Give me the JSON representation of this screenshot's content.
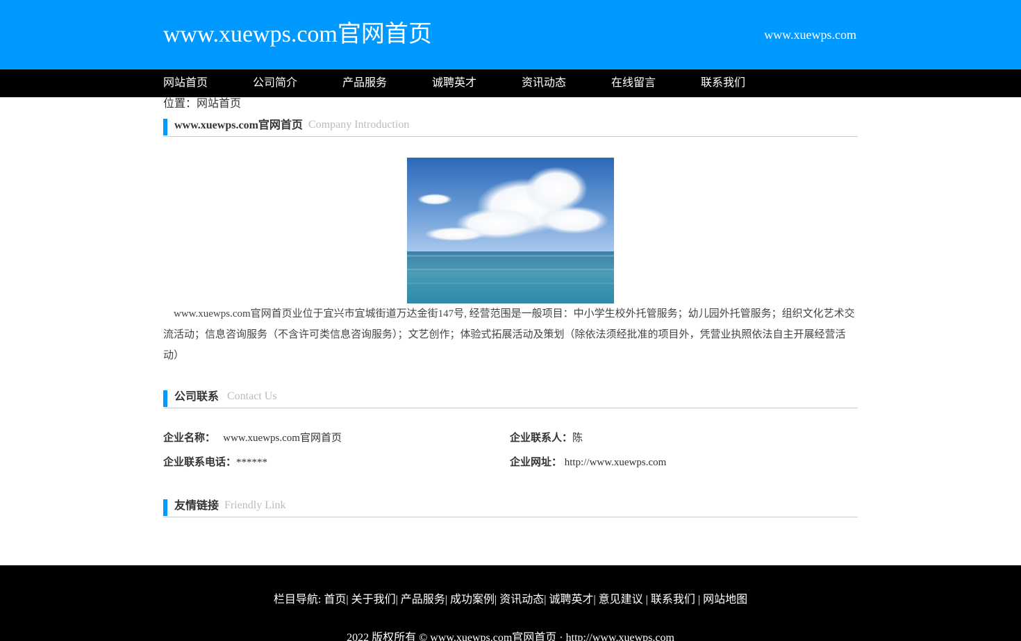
{
  "header": {
    "title": "www.xuewps.com官网首页",
    "url": "www.xuewps.com"
  },
  "nav": {
    "items": [
      "网站首页",
      "公司简介",
      "产品服务",
      "诚聘英才",
      "资讯动态",
      "在线留言",
      "联系我们"
    ]
  },
  "breadcrumb": "位置：网站首页",
  "intro": {
    "heading": "www.xuewps.com官网首页",
    "heading_en": "Company Introduction",
    "text": "www.xuewps.com官网首页业位于宜兴市宜城街道万达金街147号, 经营范围是一般项目：中小学生校外托管服务；幼儿园外托管服务；组织文化艺术交流活动；信息咨询服务（不含许可类信息咨询服务）；文艺创作；体验式拓展活动及策划（除依法须经批准的项目外，凭营业执照依法自主开展经营活动）"
  },
  "contact": {
    "heading": "公司联系",
    "heading_en": "Contact Us",
    "name_label": "企业名称：",
    "name_value": "www.xuewps.com官网首页",
    "person_label": "企业联系人：",
    "person_value": "陈",
    "phone_label": "企业联系电话：",
    "phone_value": "******",
    "site_label": "企业网址：",
    "site_value": "http://www.xuewps.com"
  },
  "links": {
    "heading": "友情链接",
    "heading_en": "Friendly Link"
  },
  "footer": {
    "nav_prefix": "栏目导航: ",
    "nav_items": [
      "首页",
      "关于我们",
      "产品服务",
      "成功案例",
      "资讯动态",
      "诚聘英才",
      "意见建议 ",
      "联系我们 ",
      "网站地图"
    ],
    "copyright": "2022 版权所有 © www.xuewps.com官网首页 · http://www.xuewps.com"
  },
  "colors": {
    "brand": "#0099ff",
    "nav_bg": "#000000"
  }
}
